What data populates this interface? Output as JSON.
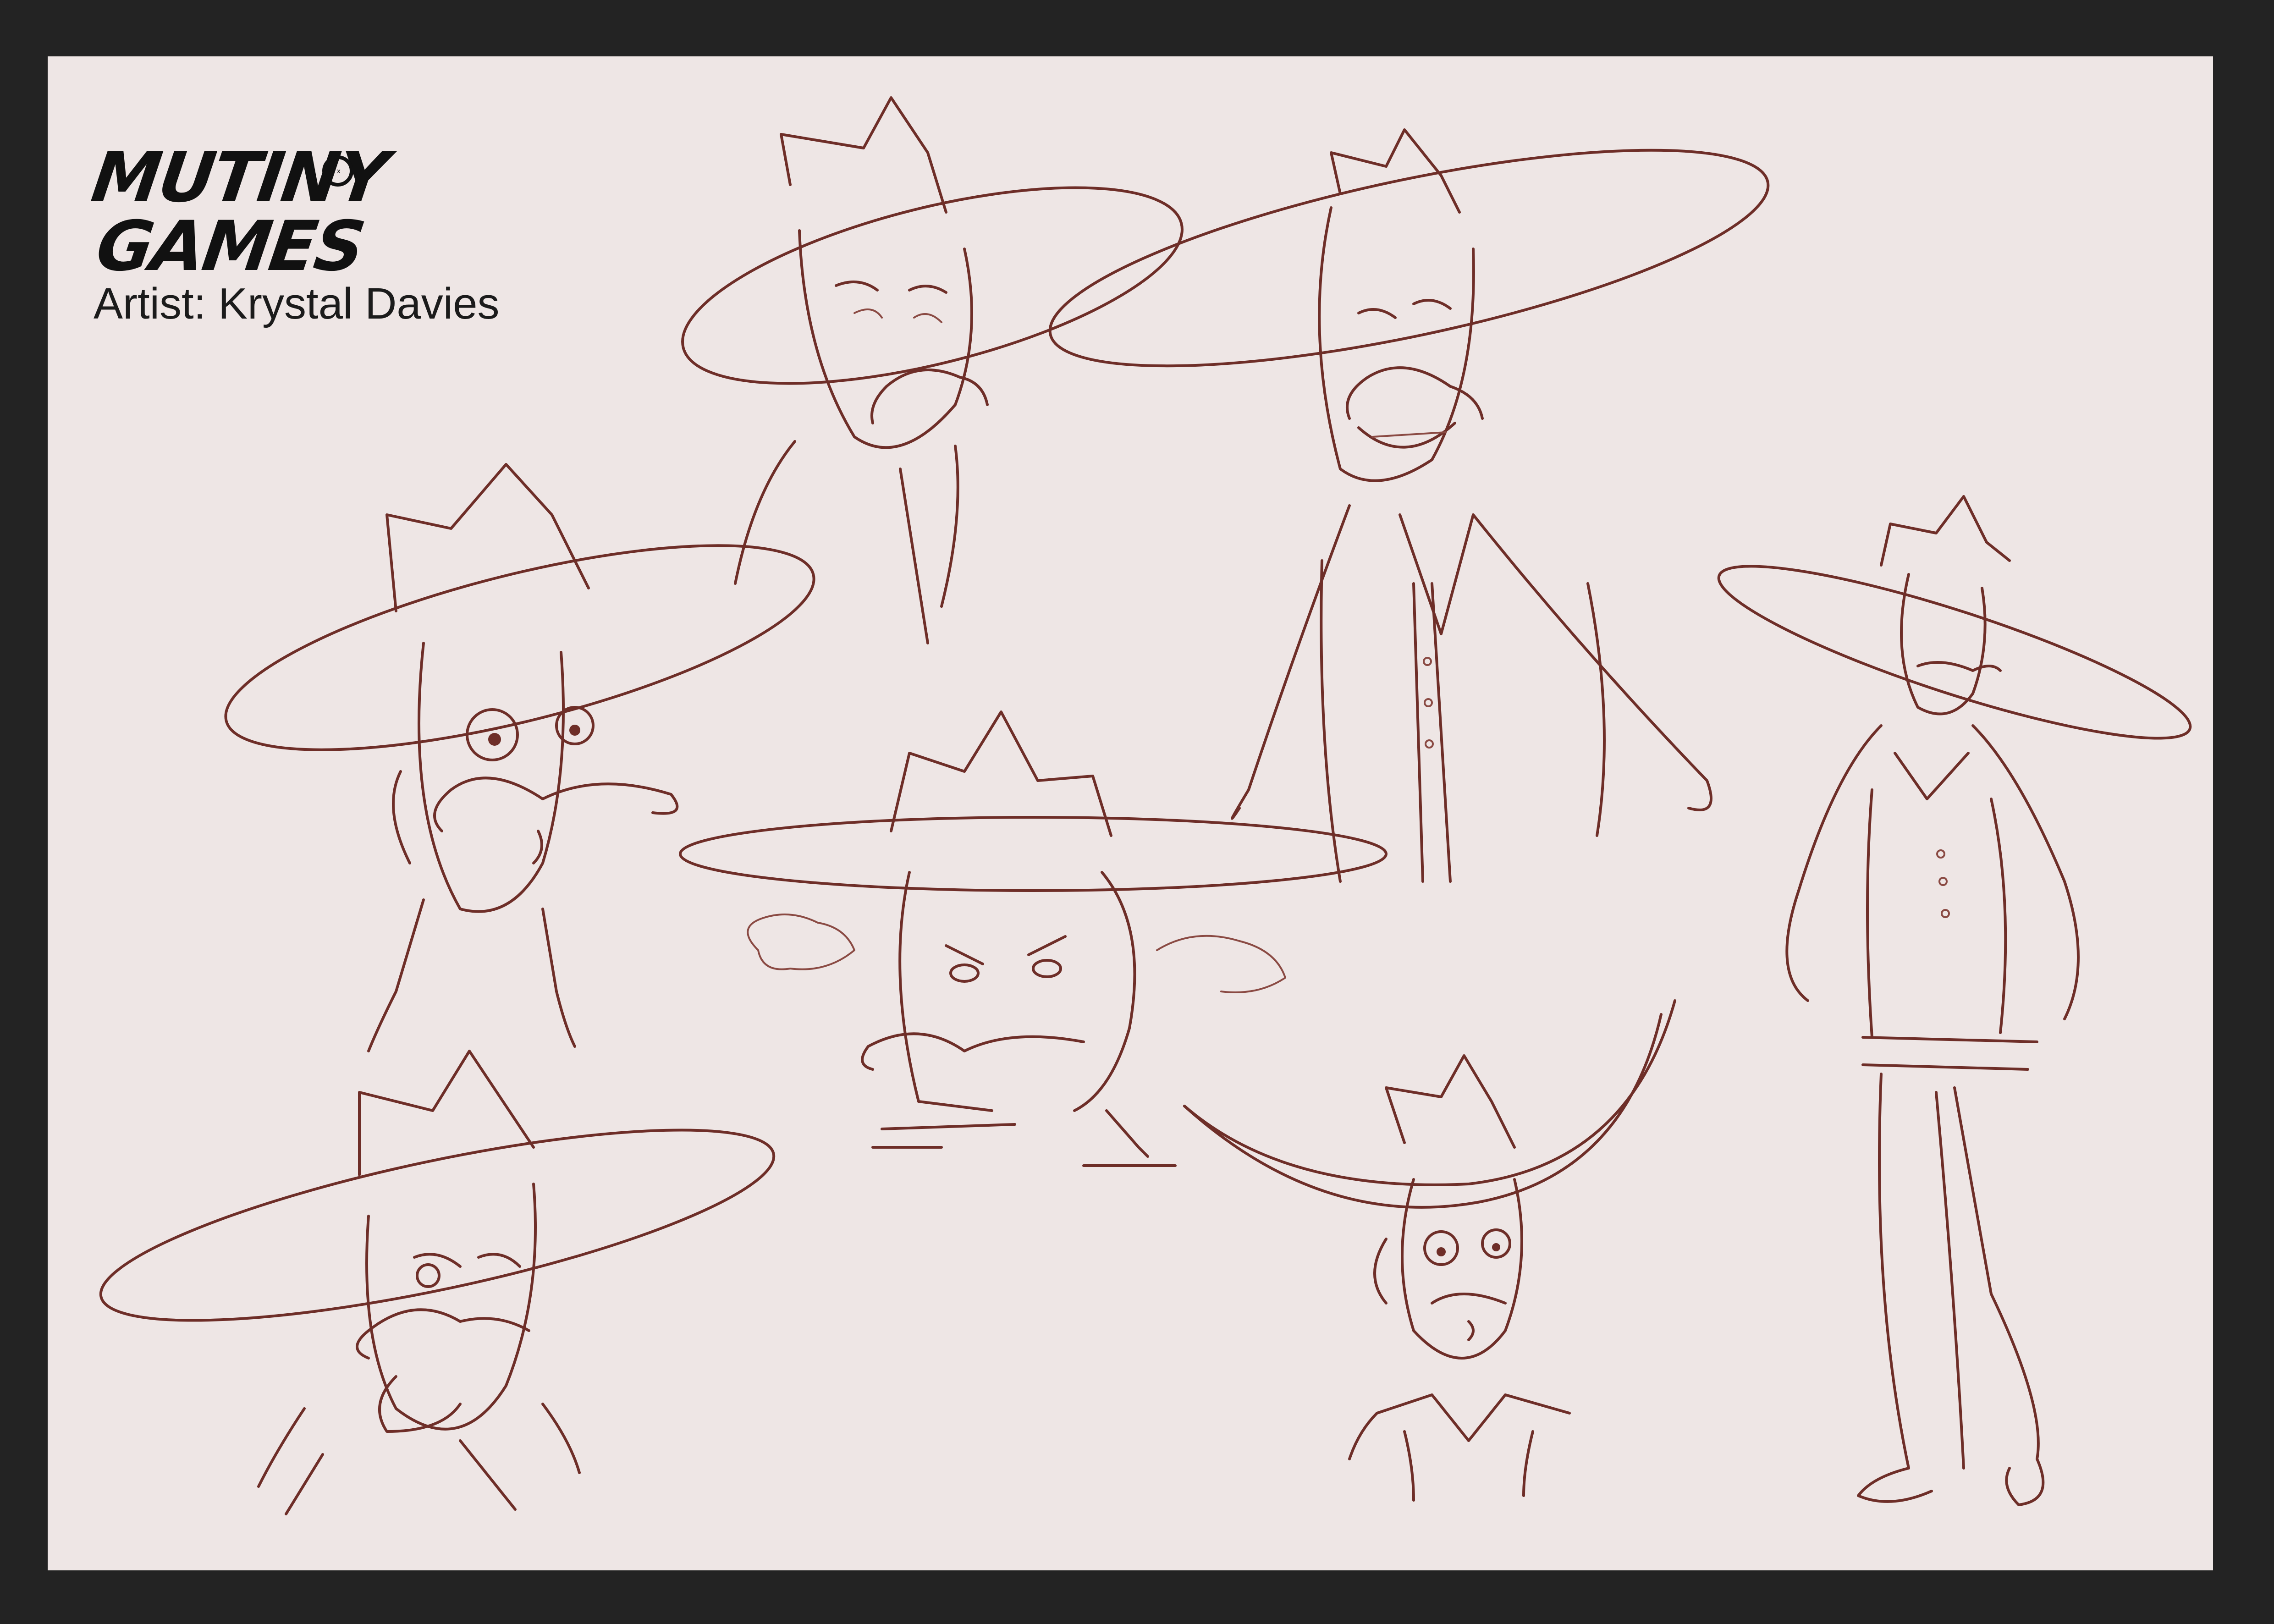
{
  "logo": {
    "line1": "MUTINY",
    "line2": "GAMES",
    "badge_icon": "skull-face-icon"
  },
  "credit": {
    "text": "Artist: Krystal Davies"
  },
  "colors": {
    "frame": "#232323",
    "paper": "#eee6e5",
    "sketch_line": "#6e2e28",
    "text": "#1b1b1b"
  },
  "sketches": [
    {
      "subject": "cowboy-head-sad"
    },
    {
      "subject": "cowboy-bust-grinning"
    },
    {
      "subject": "cowboy-head-surprised"
    },
    {
      "subject": "cowboy-head-angry"
    },
    {
      "subject": "cowboy-full-body-standing"
    },
    {
      "subject": "cowboy-head-scheming"
    },
    {
      "subject": "cowboy-head-nervous"
    }
  ]
}
